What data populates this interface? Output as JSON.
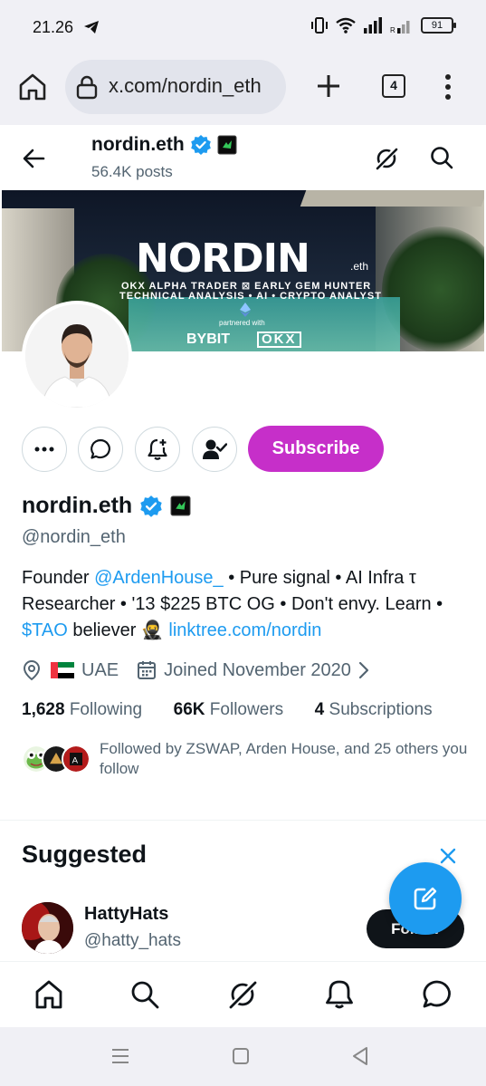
{
  "status_bar": {
    "time": "21.26",
    "battery": "91"
  },
  "browser": {
    "url": "x.com/nordin_eth",
    "tab_count": "4"
  },
  "header": {
    "name": "nordin.eth",
    "posts": "56.4K posts"
  },
  "banner": {
    "title": "NORDIN",
    "suffix": ".eth",
    "line1": "OKX ALPHA TRADER ⊠ EARLY GEM HUNTER",
    "line2": "TECHNICAL ANALYSIS • AI • CRYPTO ANALYST",
    "partnered": "partnered with",
    "bybit": "BYBIT",
    "okx": "OKX"
  },
  "actions": {
    "subscribe_label": "Subscribe"
  },
  "profile": {
    "name": "nordin.eth",
    "handle": "@nordin_eth",
    "bio_1": "Founder ",
    "bio_mention": "@ArdenHouse_",
    "bio_2": " • Pure signal • AI Infra τ Researcher • '13 $225 BTC OG • Don't envy. Learn • ",
    "bio_cashtag": "$TAO",
    "bio_3": " believer 🥷 ",
    "bio_link": "linktree.com/nordin",
    "location": "UAE",
    "joined": "Joined November 2020",
    "following_count": "1,628",
    "following_label": "Following",
    "followers_count": "66K",
    "followers_label": "Followers",
    "subscriptions_count": "4",
    "subscriptions_label": "Subscriptions",
    "followed_by": "Followed by ZSWAP, Arden House, and 25 others you follow"
  },
  "suggested": {
    "title": "Suggested",
    "user": {
      "name": "HattyHats",
      "handle": "@hatty_hats",
      "follow_label": "Follow"
    }
  },
  "colors": {
    "accent": "#1d9bf0",
    "subscribe": "#c62fc9",
    "text": "#0f1419",
    "muted": "#536471"
  }
}
